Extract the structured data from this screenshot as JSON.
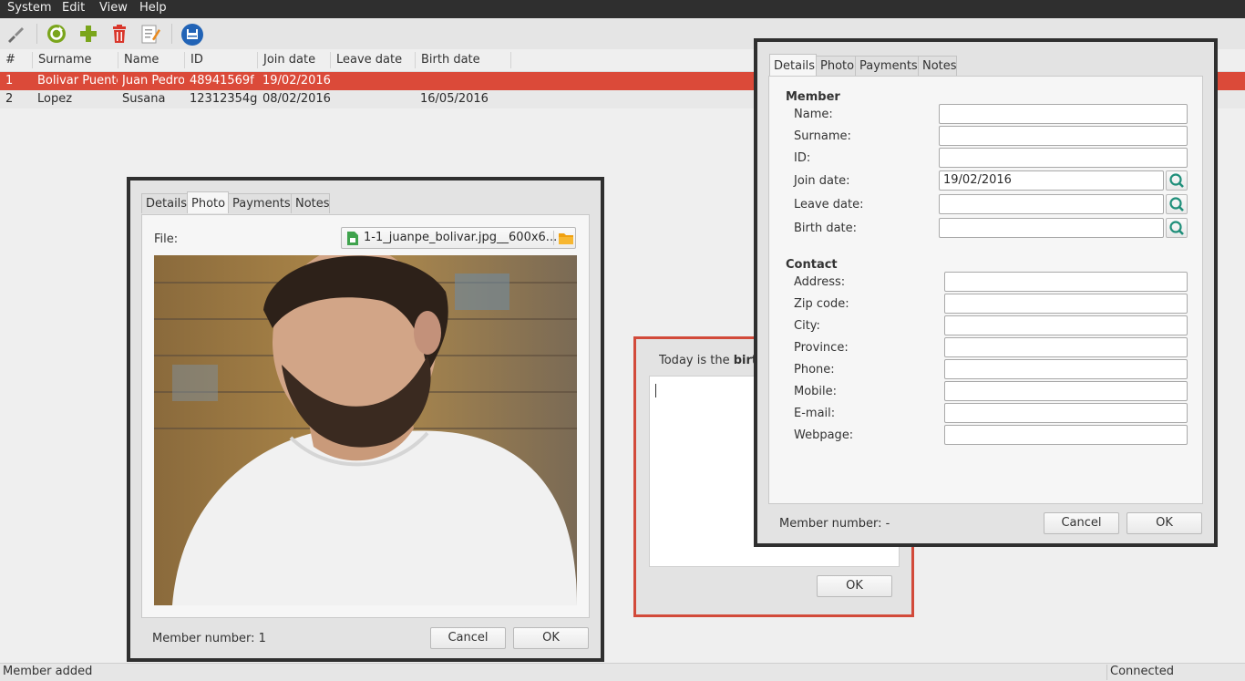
{
  "menu": [
    "System",
    "Edit",
    "View",
    "Help"
  ],
  "toolbar_icons": [
    "brush-icon",
    "refresh-icon",
    "add-icon",
    "delete-icon",
    "edit-icon",
    "backup-icon"
  ],
  "colors": {
    "selection": "#db4a39",
    "accent_green": "#7aa51b",
    "delete_red": "#d9362b",
    "save_blue": "#2163b6",
    "alert_border": "#d24a3a"
  },
  "table": {
    "headers": [
      "#",
      "Surname",
      "Name",
      "ID",
      "Join date",
      "Leave date",
      "Birth date"
    ],
    "rows": [
      [
        "1",
        "Bolivar Puente",
        "Juan Pedro",
        "48941569f",
        "19/02/2016",
        "",
        ""
      ],
      [
        "2",
        "Lopez",
        "Susana",
        "12312354g",
        "08/02/2016",
        "",
        "16/05/2016"
      ]
    ]
  },
  "tabs": [
    "Details",
    "Photo",
    "Payments",
    "Notes"
  ],
  "photo_dialog": {
    "file_label": "File:",
    "file_name": "1-1_juanpe_bolivar.jpg__600x6...",
    "member_number": "Member number: 1",
    "cancel": "Cancel",
    "ok": "OK"
  },
  "birthday_dialog": {
    "text_prefix": "Today is the ",
    "text_bold": "birth",
    "ok": "OK"
  },
  "details_dialog": {
    "member_heading": "Member",
    "fields": [
      {
        "label": "Name:",
        "value": ""
      },
      {
        "label": "Surname:",
        "value": ""
      },
      {
        "label": "ID:",
        "value": ""
      },
      {
        "label": "Join date:",
        "value": "19/02/2016"
      },
      {
        "label": "Leave date:",
        "value": ""
      },
      {
        "label": "Birth date:",
        "value": ""
      }
    ],
    "contact_heading": "Contact",
    "contact_fields": [
      {
        "label": "Address:",
        "value": ""
      },
      {
        "label": "Zip code:",
        "value": ""
      },
      {
        "label": "City:",
        "value": ""
      },
      {
        "label": "Province:",
        "value": ""
      },
      {
        "label": "Phone:",
        "value": ""
      },
      {
        "label": "Mobile:",
        "value": ""
      },
      {
        "label": "E-mail:",
        "value": ""
      },
      {
        "label": "Webpage:",
        "value": ""
      }
    ],
    "member_number": "Member number: -",
    "cancel": "Cancel",
    "ok": "OK"
  },
  "status": {
    "left": "Member added",
    "right": "Connected"
  }
}
